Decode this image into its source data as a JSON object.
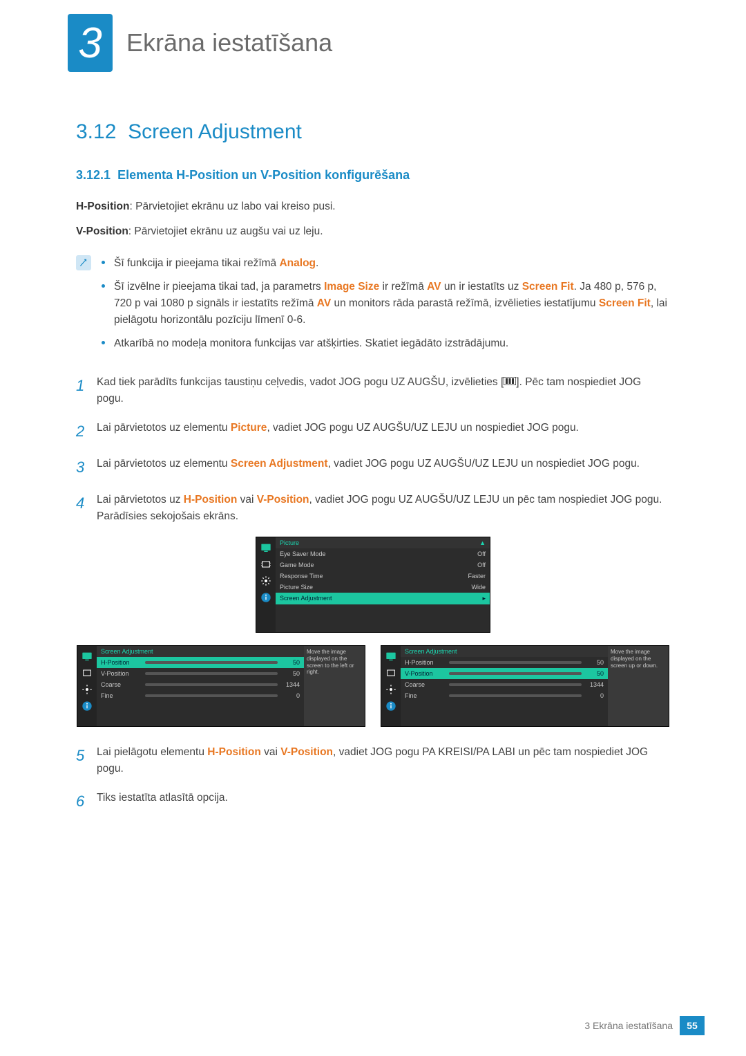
{
  "chapter_badge": "3",
  "page_heading": "Ekrāna iestatīšana",
  "sec312_num": "3.12",
  "sec312_title": "Screen Adjustment",
  "sec3121_num": "3.12.1",
  "sec3121_title": "Elementa H-Position un V-Position konfigurēšana",
  "hpos_label": "H-Position",
  "hpos_desc": ": Pārvietojiet ekrānu uz labo vai kreiso pusi.",
  "vpos_label": "V-Position",
  "vpos_desc": ": Pārvietojiet ekrānu uz augšu vai uz leju.",
  "notes": {
    "n1a": "Šī funkcija ir pieejama tikai režīmā ",
    "n1_mode": "Analog",
    "n1b": ".",
    "n2a": "Šī izvēlne ir pieejama tikai tad, ja parametrs ",
    "n2_imgsize": "Image Size",
    "n2b": " ir režīmā ",
    "n2_av": "AV",
    "n2c": " un ir iestatīts uz ",
    "n2_fit": "Screen Fit",
    "n2d": ". Ja 480 p, 576 p, 720 p vai 1080 p signāls ir iestatīts režīmā ",
    "n2_av2": "AV",
    "n2e": " un monitors rāda parastā režīmā, izvēlieties iestatījumu ",
    "n2_fit2": "Screen Fit",
    "n2f": ", lai pielāgotu horizontālu pozīciju līmenī 0-6.",
    "n3": "Atkarībā no modeļa monitora funkcijas var atšķirties. Skatiet iegādāto izstrādājumu."
  },
  "step_labels": {
    "s1": "1",
    "s2": "2",
    "s3": "3",
    "s4": "4",
    "s5": "5",
    "s6": "6"
  },
  "steps": {
    "s1": "Kad tiek parādīts funkcijas taustiņu ceļvedis, vadot JOG pogu UZ AUGŠU, izvēlieties [",
    "s1b": "]. Pēc tam nospiediet JOG pogu.",
    "s2a": "Lai pārvietotos uz elementu ",
    "s2_pic": "Picture",
    "s2b": ", vadiet JOG pogu UZ AUGŠU/UZ LEJU un nospiediet JOG pogu.",
    "s3a": "Lai pārvietotos uz elementu ",
    "s3_sa": "Screen Adjustment",
    "s3b": ", vadiet JOG pogu UZ AUGŠU/UZ LEJU un nospiediet JOG pogu.",
    "s4a": "Lai pārvietotos uz ",
    "s4_h": "H-Position",
    "s4_or": " vai ",
    "s4_v": "V-Position",
    "s4b": ", vadiet JOG pogu UZ AUGŠU/UZ LEJU un pēc tam nospiediet JOG pogu.",
    "s4c": "Parādīsies sekojošais ekrāns.",
    "s5a": "Lai pielāgotu elementu ",
    "s5_h": "H-Position",
    "s5_or": " vai ",
    "s5_v": "V-Position",
    "s5b": ", vadiet JOG pogu PA KREISI/PA LABI un pēc tam nospiediet JOG pogu.",
    "s6": "Tiks iestatīta atlasītā opcija."
  },
  "osd1": {
    "head": "Picture",
    "rows": [
      {
        "label": "Eye Saver Mode",
        "value": "Off"
      },
      {
        "label": "Game Mode",
        "value": "Off"
      },
      {
        "label": "Response Time",
        "value": "Faster"
      },
      {
        "label": "Picture Size",
        "value": "Wide"
      }
    ],
    "sel": "Screen Adjustment"
  },
  "osd2": {
    "head": "Screen Adjustment",
    "rows": [
      {
        "label": "H-Position",
        "val": "50",
        "pct": 50
      },
      {
        "label": "V-Position",
        "val": "50",
        "pct": 50
      },
      {
        "label": "Coarse",
        "val": "1344",
        "pct": 65
      },
      {
        "label": "Fine",
        "val": "0",
        "pct": 0
      }
    ],
    "hint": "Move the image displayed on the screen to the left or right.",
    "sel_index": 0
  },
  "osd3": {
    "head": "Screen Adjustment",
    "rows": [
      {
        "label": "H-Position",
        "val": "50",
        "pct": 50
      },
      {
        "label": "V-Position",
        "val": "50",
        "pct": 50
      },
      {
        "label": "Coarse",
        "val": "1344",
        "pct": 65
      },
      {
        "label": "Fine",
        "val": "0",
        "pct": 0
      }
    ],
    "hint": "Move the image displayed on the screen up or down.",
    "sel_index": 1
  },
  "footer_label": "3 Ekrāna iestatīšana",
  "page_number": "55"
}
